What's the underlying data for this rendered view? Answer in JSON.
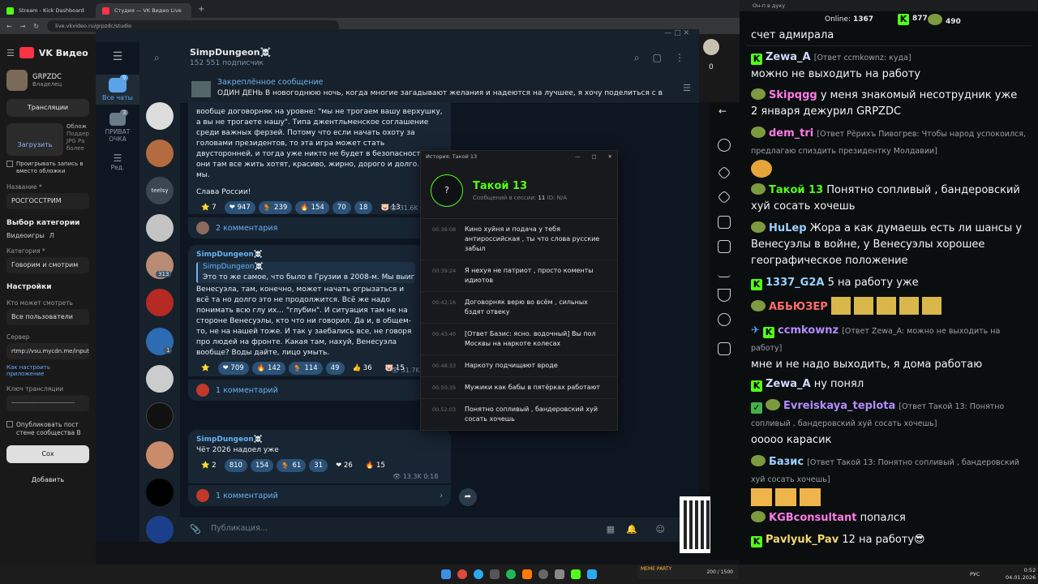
{
  "browser": {
    "tabs": [
      {
        "label": "Stream - Kick Dashboard"
      },
      {
        "label": "Студия — VK Видео Live"
      }
    ],
    "url": "live.vkvideo.ru/grpzdc/studio"
  },
  "vk": {
    "brand": "VK Видео",
    "channel": "GRPZDC",
    "role": "Владелец",
    "tabs_label": "Трансляции",
    "cover": {
      "title": "Облож",
      "upload": "Загрузить",
      "hint1": "Поддер",
      "hint2": "JPG Ра",
      "hint3": "более"
    },
    "repeat_label": "Проигрывать запись в",
    "repeat_label2": "вместо обложки",
    "name_label": "Название *",
    "name_value": "РОСГОССТРИМ",
    "category_section": "Выбор категории",
    "category_videogames": "Видеоигры",
    "category_ext": "Л",
    "category_label": "Категория *",
    "category_value": "Говорим и смотрим",
    "settings": "Настройки",
    "who_label": "Кто может смотреть",
    "who_value": "Все пользователи",
    "server_label": "Сервер",
    "server_value": "rtmp://vsu.mycdn.me/input",
    "howto": "Как настроить приложение",
    "key_label": "Ключ трансляции",
    "key_value": "------------------------------------",
    "publish_label": "Опубликовать пост",
    "publish_label2": "стене сообщества В",
    "save": "Сох",
    "add": "Добавить",
    "counter": "0"
  },
  "tg": {
    "rail": [
      {
        "label": "Все чаты",
        "badge": "9"
      },
      {
        "label": "ПРИВАТ ОЧКА",
        "badge": "3"
      },
      {
        "label": "Ред."
      }
    ],
    "channel": "SimpDungeon☠️",
    "subs": "152 551 подписчик",
    "pinned_title": "Закреплённое сообщение",
    "pinned_text": "ОДИН ДЕНЬ  В новогоднюю ночь, когда многие загадывают желания и надеются на лучшее, я хочу поделиться с в...",
    "chat_badge_313": "313",
    "chat_badge_1": "1",
    "chat_teelsy": "teelsy",
    "post1": {
      "text": "вообще договорняк на уровне: \"мы не трогаем вашу верхушку, а вы не трогаете нашу\". Типа джентльменское соглашение среди важных ферзей. Потому что если начать охоту за головами президентов, то эта игра может стать двусторонней, и тогда уже никто не будет в безопасности. А они там все жить хотят, красиво, жирно, дорого и долго. Как и мы.",
      "sign": "Слава России!",
      "reacts": [
        "⭐ 7",
        "❤ 947",
        "🐓 239",
        "🔥 154",
        "70",
        "18",
        "🐷 13"
      ],
      "views": "31.6K",
      "comments": "2 комментария"
    },
    "post2": {
      "author": "SimpDungeon☠️",
      "reply_author": "SimpDungeon☠️",
      "reply_text": "Это то же самое, что было в Грузии в 2008-м. Мы выиграл",
      "text": "Венесуэла, там, конечно, может начать огрызаться и всё та но долго это не продолжится. Всё же надо понимать всю глу их... \"глубин\". И ситуация там не на стороне Венесуэлы, кто что ни говорил. Да и, в общем-то, не на нашей тоже. И так у заебались все, не говоря про людей на фронте. Какая там, нахуй, Венесуэла вообще? Воды дайте, лицо умыть.",
      "reacts": [
        "⭐",
        "❤ 709",
        "🔥 142",
        "🐓 114",
        "49",
        "👍 36",
        "🐷 15"
      ],
      "views": "31.7K",
      "comments": "1 комментарий"
    },
    "post3": {
      "author": "SimpDungeon☠️",
      "text": "Чёт 2026 надоел уже",
      "reacts": [
        "⭐ 2",
        "810",
        "154",
        "🐓 61",
        "31",
        "❤ 26",
        "🔥 15"
      ],
      "views": "13.3K",
      "time": "0:18",
      "comments": "1 комментарий"
    },
    "composer_placeholder": "Публикация..."
  },
  "history": {
    "window_title": "История: Такой 13",
    "name": "Такой 13",
    "meta_label": "Сообщений в сессии:",
    "meta_count": "11",
    "meta_id": "ID: N/A",
    "avatar": "?",
    "items": [
      {
        "time": "00:36:08",
        "text": "Кино хуйня и подача у тебя антироссийская , ты что слова русские забыл"
      },
      {
        "time": "00:39:24",
        "text": "Я нехуя не патриот , просто коменты идиотов"
      },
      {
        "time": "00:42:16",
        "text": "Договорняк верю во всём , сильных бздят отвеку"
      },
      {
        "time": "00:43:40",
        "text": "[Ответ Базис: ясно. водочный] Вы пол Москвы на наркоте колесах"
      },
      {
        "time": "00:48:33",
        "text": "Наркоту подчищают вроде"
      },
      {
        "time": "00:50:35",
        "text": "Мужики как бабы в пятёрках работают"
      },
      {
        "time": "00:52:03",
        "text": "Понятно сопливый , бандеровский хуй сосать хочешь"
      }
    ]
  },
  "kick": {
    "window_title": "Он-п в дуку",
    "online_label": "Online:",
    "online": "1367",
    "k_count": "877",
    "p_count": "490",
    "messages": [
      {
        "user": "",
        "reply": "",
        "text": "счет адмирала"
      },
      {
        "user": "Zewa_A",
        "reply": "[Ответ ccmkownz: куда]",
        "text": "можно не выходить на работу",
        "color": "#cfd9ff"
      },
      {
        "user": "Skipqgg",
        "reply": "",
        "text": "у меня знакомый несотрудник уже 2 января дежурил GRPZDC",
        "color": "#ff7be8"
      },
      {
        "user": "dem_tri",
        "reply": "[Ответ Рёрихъ Пивогрев: Чтобы народ успокоился, предлагаю спиздить президентку Молдавии]",
        "text": "",
        "color": "#ff7be8"
      },
      {
        "user": "Такой 13",
        "reply": "",
        "text": "Понятно сопливый , бандеровский хуй сосать хочешь",
        "color": "#53fc18"
      },
      {
        "user": "HuLep",
        "reply": "",
        "text": "Жора а как думаешь есть ли шансы у Венесуэлы в войне, у Венесуэлы хорошее географическое положение",
        "color": "#9bd0ff"
      },
      {
        "user": "1337_G2A",
        "reply": "",
        "text": "5 на работу уже",
        "color": "#9bd0ff"
      },
      {
        "user": "АБЬЮЗЕР",
        "reply": "",
        "text": "",
        "color": "#ff6b6b"
      },
      {
        "user": "ccmkownz",
        "reply": "[Ответ Zewa_A: можно не выходить на работу]",
        "text": "мне и не надо выходить, я дома работаю",
        "color": "#b48cff"
      },
      {
        "user": "Zewa_A",
        "reply": "",
        "text": "ну понял",
        "color": "#cfd9ff"
      },
      {
        "user": "Evreiskaya_teplota",
        "reply": "[Ответ Такой 13: Понятно сопливый , бандеровский хуй сосать хочешь]",
        "text": "ооооо карасик",
        "color": "#b48cff"
      },
      {
        "user": "Базис",
        "reply": "[Ответ Такой 13: Понятно сопливый , бандеровский хуй сосать хочешь]",
        "text": "",
        "color": "#9bd0ff"
      },
      {
        "user": "KGBconsultant",
        "reply": "",
        "text": "попался",
        "color": "#ff7be8"
      },
      {
        "user": "Pavlyuk_Pav",
        "reply": "",
        "text": "12 на работу😎",
        "color": "#f5d76e"
      }
    ]
  },
  "taskbar": {
    "lang": "РУС",
    "time": "0:52",
    "date": "04.01.2026",
    "meme": "MEME PARTY",
    "meme_count": "200 / 1500"
  }
}
